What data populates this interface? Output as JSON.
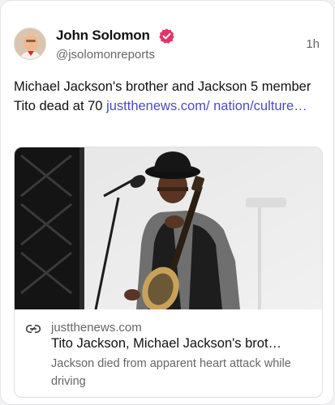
{
  "post": {
    "author_name": "John Solomon",
    "author_handle": "@jsolomonreports",
    "timestamp": "1h",
    "text": "Michael Jackson's brother and Jackson 5 member Tito dead at 70 ",
    "link_text": "justthenews.com/ nation/culture…",
    "verified_color": "#e0356b",
    "link_color": "#4b4bc4"
  },
  "card": {
    "domain": "justthenews.com",
    "title": "Tito Jackson, Michael Jackson's brot…",
    "description": "Jackson died from apparent heart attack while driving",
    "icon": "link-icon"
  }
}
